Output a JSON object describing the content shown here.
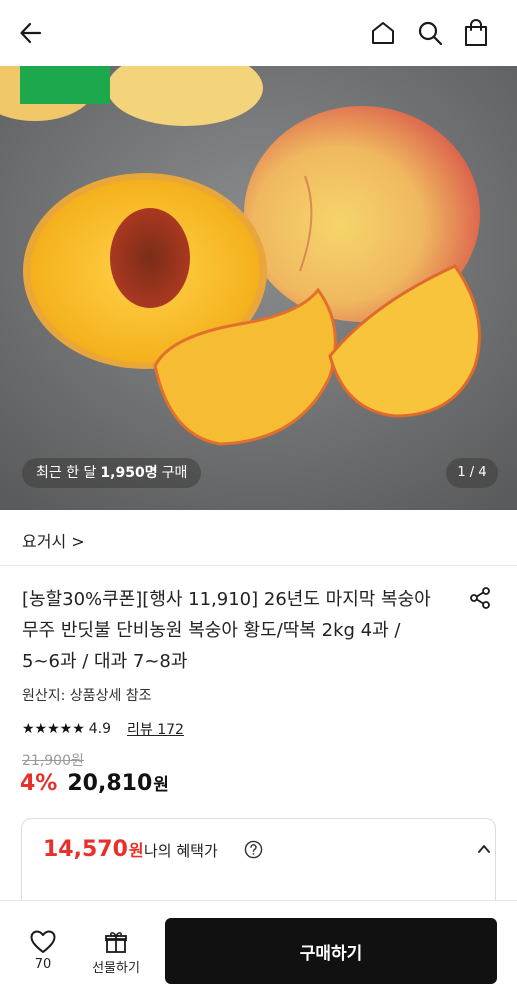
{
  "header": {
    "back_icon": "arrow-left-icon",
    "home_icon": "home-icon",
    "search_icon": "search-icon",
    "bag_icon": "shopping-bag-icon"
  },
  "hero": {
    "recent_prefix": "최근 한 달",
    "recent_count": "1,950명",
    "recent_suffix": "구매",
    "pager": "1 / 4"
  },
  "store": {
    "name": "요거시 >"
  },
  "product": {
    "title": "[농할30%쿠폰][행사 11,910] 26년도 마지막 복숭아 무주 반딧불 단비농원 복숭아 황도/딱복 2kg 4과 / 5~6과 / 대과 7~8과",
    "origin": "원산지: 상품상세 참조",
    "stars": "★★★★★",
    "rating": "4.9",
    "reviews": "리뷰 172",
    "original_price": "21,900원",
    "discount": "4%",
    "price": "20,810",
    "price_unit": "원"
  },
  "benefit": {
    "price": "14,570",
    "unit": "원",
    "label": "나의 혜택가"
  },
  "bottom": {
    "like_count": "70",
    "gift_label": "선물하기",
    "buy_label": "구매하기"
  },
  "colors": {
    "accent_red": "#e8302a",
    "buy_button": "#111111"
  }
}
